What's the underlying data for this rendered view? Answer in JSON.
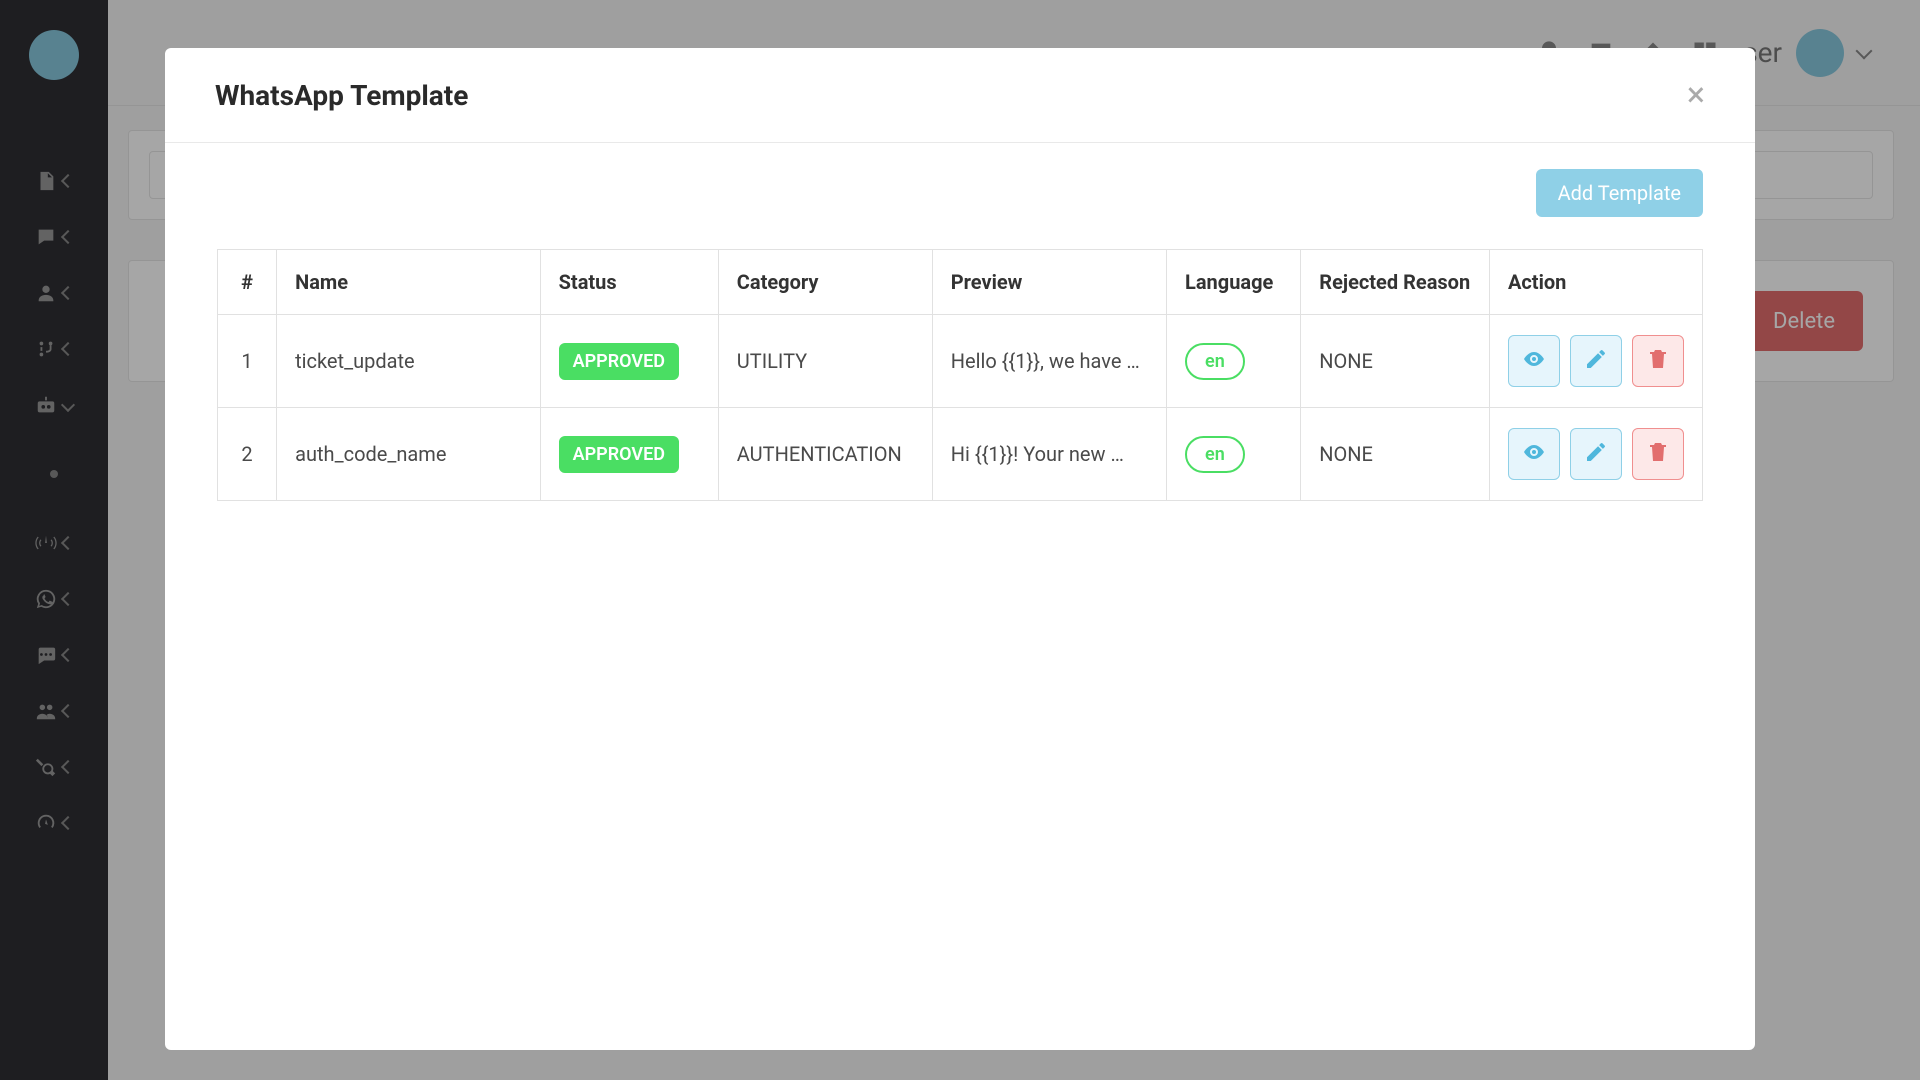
{
  "user": {
    "label": "ser"
  },
  "background": {
    "delete_button": "Delete"
  },
  "modal": {
    "title": "WhatsApp Template",
    "add_button": "Add Template",
    "columns": {
      "index": "#",
      "name": "Name",
      "status": "Status",
      "category": "Category",
      "preview": "Preview",
      "language": "Language",
      "rejected": "Rejected Reason",
      "action": "Action"
    },
    "rows": [
      {
        "index": "1",
        "name": "ticket_update",
        "status": "APPROVED",
        "category": "UTILITY",
        "preview": "Hello {{1}}, we have …",
        "language": "en",
        "rejected": "NONE"
      },
      {
        "index": "2",
        "name": "auth_code_name",
        "status": "APPROVED",
        "category": "AUTHENTICATION",
        "preview": "Hi {{1}}! Your new …",
        "language": "en",
        "rejected": "NONE"
      }
    ]
  }
}
